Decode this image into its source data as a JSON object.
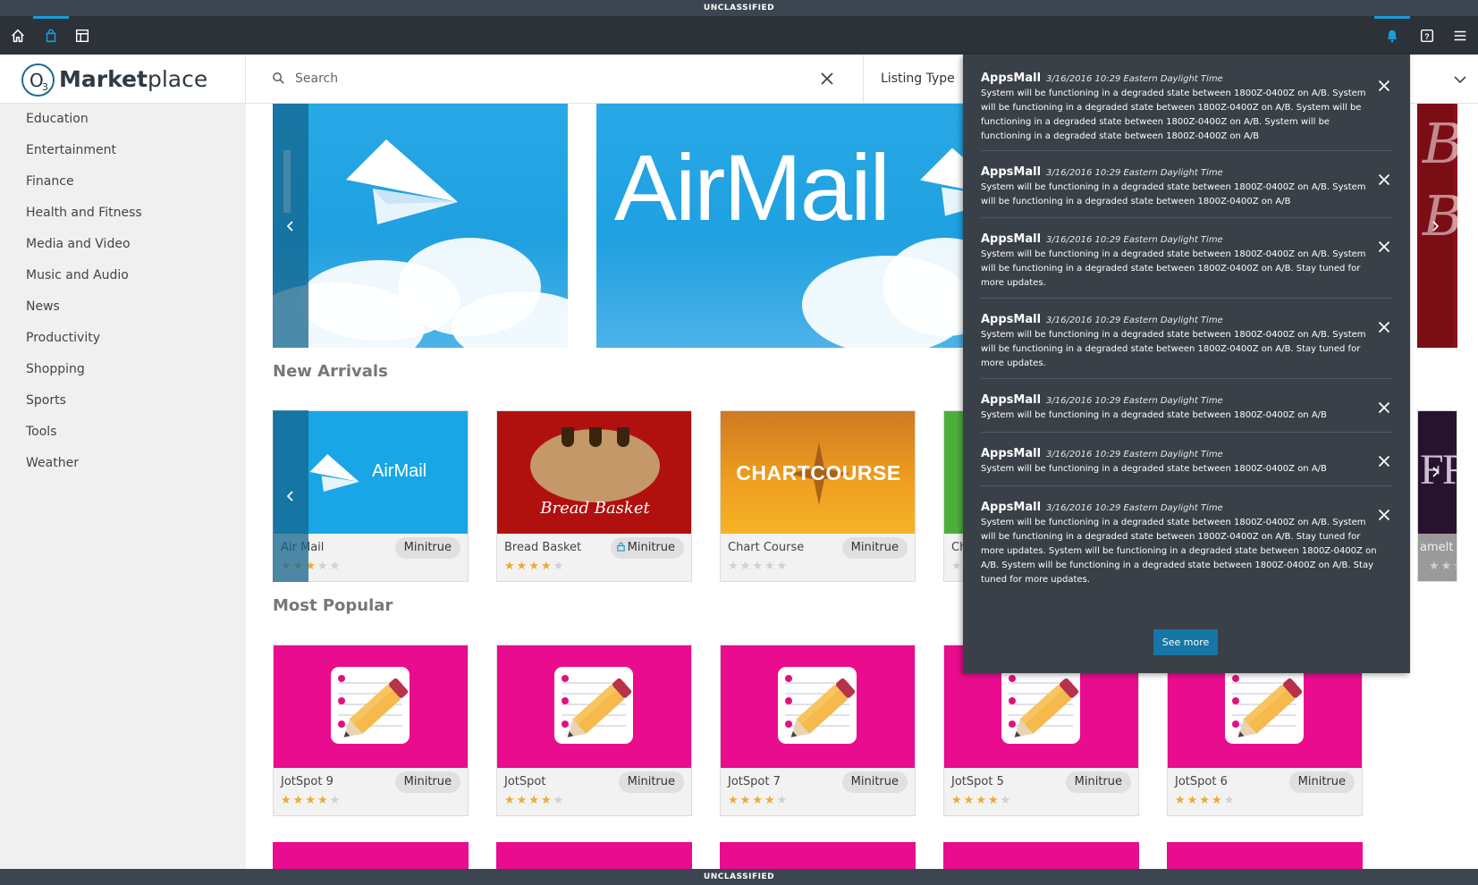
{
  "classification": {
    "top": "UNCLASSIFIED",
    "bottom": "UNCLASSIFIED"
  },
  "brand": {
    "o": "O",
    "sub": "3",
    "name_bold": "Market",
    "name_rest": "place"
  },
  "search": {
    "placeholder": "Search",
    "listing_type": "Listing Type"
  },
  "categories": [
    "Education",
    "Entertainment",
    "Finance",
    "Health and Fitness",
    "Media and Video",
    "Music and Audio",
    "News",
    "Productivity",
    "Shopping",
    "Sports",
    "Tools",
    "Weather"
  ],
  "featured": {
    "banner_text": "AirMail"
  },
  "sections": {
    "new_arrivals": "New Arrivals",
    "most_popular": "Most Popular"
  },
  "new_arrivals": [
    {
      "name": "Air Mail",
      "org": "Minitrue",
      "rating": 3,
      "logo_text": "AirMail"
    },
    {
      "name": "Bread Basket",
      "org": "Minitrue",
      "rating": 4,
      "logo_text": "Bread Basket"
    },
    {
      "name": "Chart Course",
      "org": "Minitrue",
      "rating": 0,
      "logo_text": "CHARTCOURSE"
    },
    {
      "name": "Ch",
      "org": "",
      "rating": 0
    },
    {
      "name": "amelt",
      "org": "",
      "rating": 0,
      "logo_text": "FR"
    }
  ],
  "most_popular": [
    {
      "name": "JotSpot 9",
      "org": "Minitrue",
      "rating": 4
    },
    {
      "name": "JotSpot",
      "org": "Minitrue",
      "rating": 4
    },
    {
      "name": "JotSpot 7",
      "org": "Minitrue",
      "rating": 4
    },
    {
      "name": "JotSpot 5",
      "org": "Minitrue",
      "rating": 4
    },
    {
      "name": "JotSpot 6",
      "org": "Minitrue",
      "rating": 4
    }
  ],
  "notifications": {
    "see_more": "See more",
    "items": [
      {
        "source": "AppsMall",
        "time": "3/16/2016  10:29 Eastern Daylight Time",
        "message": "System will be functioning in a degraded state between 1800Z-0400Z on A/B. System will be functioning in a degraded state between 1800Z-0400Z on A/B. System will be functioning in a degraded state between 1800Z-0400Z on A/B. System will be functioning in a degraded state between 1800Z-0400Z on A/B"
      },
      {
        "source": "AppsMall",
        "time": "3/16/2016  10:29 Eastern Daylight Time",
        "message": "System will be functioning in a degraded state between 1800Z-0400Z on A/B. System will be functioning in a degraded state between 1800Z-0400Z on A/B"
      },
      {
        "source": "AppsMall",
        "time": "3/16/2016  10:29 Eastern Daylight Time",
        "message": "System will be functioning in a degraded state between 1800Z-0400Z on A/B. System will be functioning in a degraded state between 1800Z-0400Z on A/B. Stay tuned for more updates."
      },
      {
        "source": "AppsMall",
        "time": "3/16/2016  10:29 Eastern Daylight Time",
        "message": "System will be functioning in a degraded state between 1800Z-0400Z on A/B. System will be functioning in a degraded state between 1800Z-0400Z on A/B. Stay tuned for more updates."
      },
      {
        "source": "AppsMall",
        "time": "3/16/2016  10:29 Eastern Daylight Time",
        "message": "System will be functioning in a degraded state between 1800Z-0400Z on A/B"
      },
      {
        "source": "AppsMall",
        "time": "3/16/2016  10:29 Eastern Daylight Time",
        "message": "System will be functioning in a degraded state between 1800Z-0400Z on A/B"
      },
      {
        "source": "AppsMall",
        "time": "3/16/2016  10:29 Eastern Daylight Time",
        "message": "System will be functioning in a degraded state between 1800Z-0400Z on A/B. System will be functioning in a degraded state between 1800Z-0400Z on A/B. Stay tuned for more updates. System will be functioning in a degraded state between 1800Z-0400Z on A/B. System will be functioning in a degraded state between 1800Z-0400Z on A/B. Stay tuned for more updates."
      }
    ]
  },
  "colors": {
    "accent": "#1a9cd8",
    "navbar": "#2c3238",
    "panel": "#3a4047",
    "star": "#f0a830",
    "jotspot": "#ea0c8e",
    "bread": "#b0110f",
    "chart": "#f0a020"
  },
  "icons": [
    "home-icon",
    "marketplace-bag-icon",
    "dashboard-icon",
    "bell-icon",
    "help-icon",
    "menu-icon",
    "search-icon",
    "close-icon",
    "chevron-down-icon",
    "chevron-left-icon",
    "chevron-right-icon",
    "paper-plane-icon",
    "notepad-pencil-icon"
  ]
}
